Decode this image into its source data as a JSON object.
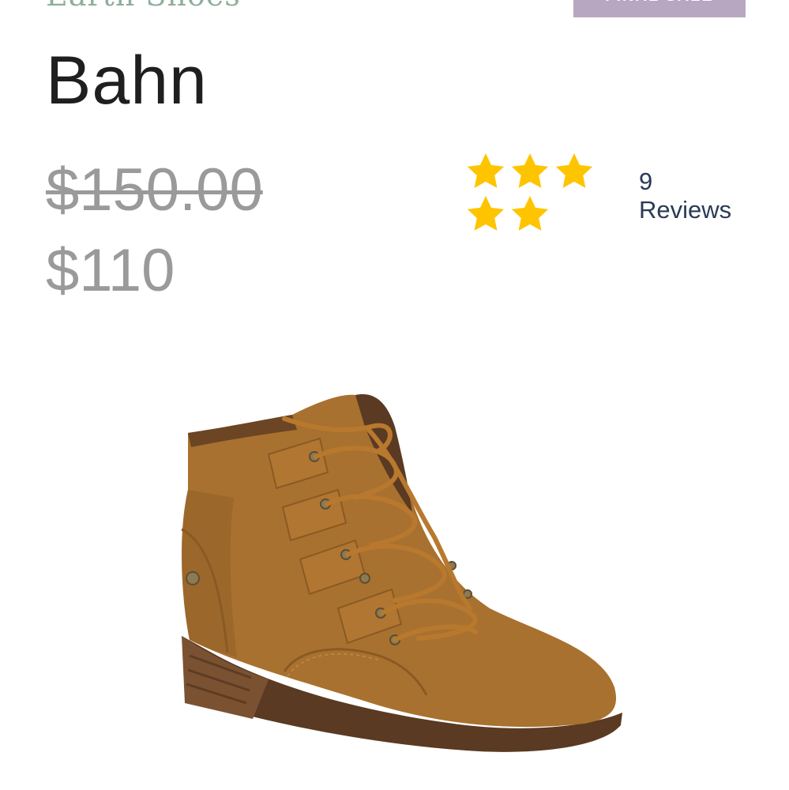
{
  "brand": "Earth Shoes",
  "badge": "FINAL SALE",
  "product": {
    "name": "Bahn",
    "original_price": "$150.00",
    "sale_price": "$110"
  },
  "rating": {
    "stars": 5,
    "value": 5,
    "count": "9",
    "count_label": "Reviews",
    "star_color": "#ffc400"
  },
  "image": {
    "subject": "tan suede lace-up ankle boot",
    "colors": {
      "suede": "#a9712f",
      "suede_dark": "#8a5a24",
      "sole": "#5a3a22",
      "heel_wood": "#7a5232"
    }
  }
}
